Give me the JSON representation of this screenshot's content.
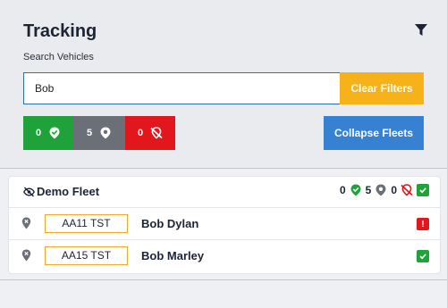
{
  "header": {
    "title": "Tracking",
    "filter_icon": "filter-icon"
  },
  "search": {
    "label": "Search Vehicles",
    "value": "Bob",
    "placeholder": "",
    "clear_label": "Clear Filters"
  },
  "status_filters": [
    {
      "count": "0",
      "icon": "location-check-icon",
      "color": "#1fa23a"
    },
    {
      "count": "5",
      "icon": "location-pin-icon",
      "color": "#6b6f77"
    },
    {
      "count": "0",
      "icon": "location-off-icon",
      "color": "#e2161d"
    }
  ],
  "collapse_label": "Collapse Fleets",
  "fleet": {
    "name": "Demo Fleet",
    "stats": {
      "online": "0",
      "idle": "5",
      "offline": "0"
    },
    "vehicles": [
      {
        "plate": "AA11 TST",
        "driver": "Bob Dylan",
        "status": "alert"
      },
      {
        "plate": "AA15 TST",
        "driver": "Bob Marley",
        "status": "ok"
      }
    ]
  },
  "colors": {
    "accent_blue": "#3781d3",
    "accent_orange": "#f7b21a",
    "green": "#1fa23a",
    "red": "#e2161d",
    "grey": "#6b6f77"
  }
}
